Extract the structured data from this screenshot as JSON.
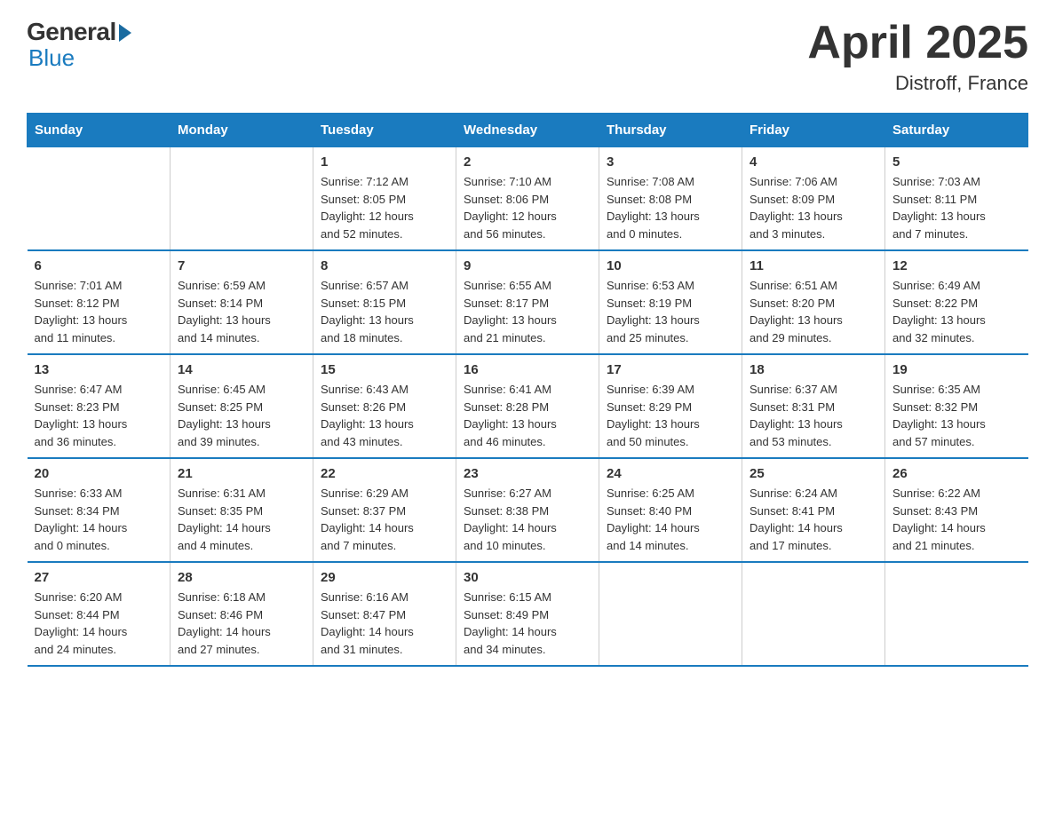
{
  "logo": {
    "general": "General",
    "blue": "Blue",
    "subtitle": "Blue"
  },
  "title": "April 2025",
  "location": "Distroff, France",
  "headers": [
    "Sunday",
    "Monday",
    "Tuesday",
    "Wednesday",
    "Thursday",
    "Friday",
    "Saturday"
  ],
  "weeks": [
    [
      {
        "day": "",
        "info": ""
      },
      {
        "day": "",
        "info": ""
      },
      {
        "day": "1",
        "info": "Sunrise: 7:12 AM\nSunset: 8:05 PM\nDaylight: 12 hours\nand 52 minutes."
      },
      {
        "day": "2",
        "info": "Sunrise: 7:10 AM\nSunset: 8:06 PM\nDaylight: 12 hours\nand 56 minutes."
      },
      {
        "day": "3",
        "info": "Sunrise: 7:08 AM\nSunset: 8:08 PM\nDaylight: 13 hours\nand 0 minutes."
      },
      {
        "day": "4",
        "info": "Sunrise: 7:06 AM\nSunset: 8:09 PM\nDaylight: 13 hours\nand 3 minutes."
      },
      {
        "day": "5",
        "info": "Sunrise: 7:03 AM\nSunset: 8:11 PM\nDaylight: 13 hours\nand 7 minutes."
      }
    ],
    [
      {
        "day": "6",
        "info": "Sunrise: 7:01 AM\nSunset: 8:12 PM\nDaylight: 13 hours\nand 11 minutes."
      },
      {
        "day": "7",
        "info": "Sunrise: 6:59 AM\nSunset: 8:14 PM\nDaylight: 13 hours\nand 14 minutes."
      },
      {
        "day": "8",
        "info": "Sunrise: 6:57 AM\nSunset: 8:15 PM\nDaylight: 13 hours\nand 18 minutes."
      },
      {
        "day": "9",
        "info": "Sunrise: 6:55 AM\nSunset: 8:17 PM\nDaylight: 13 hours\nand 21 minutes."
      },
      {
        "day": "10",
        "info": "Sunrise: 6:53 AM\nSunset: 8:19 PM\nDaylight: 13 hours\nand 25 minutes."
      },
      {
        "day": "11",
        "info": "Sunrise: 6:51 AM\nSunset: 8:20 PM\nDaylight: 13 hours\nand 29 minutes."
      },
      {
        "day": "12",
        "info": "Sunrise: 6:49 AM\nSunset: 8:22 PM\nDaylight: 13 hours\nand 32 minutes."
      }
    ],
    [
      {
        "day": "13",
        "info": "Sunrise: 6:47 AM\nSunset: 8:23 PM\nDaylight: 13 hours\nand 36 minutes."
      },
      {
        "day": "14",
        "info": "Sunrise: 6:45 AM\nSunset: 8:25 PM\nDaylight: 13 hours\nand 39 minutes."
      },
      {
        "day": "15",
        "info": "Sunrise: 6:43 AM\nSunset: 8:26 PM\nDaylight: 13 hours\nand 43 minutes."
      },
      {
        "day": "16",
        "info": "Sunrise: 6:41 AM\nSunset: 8:28 PM\nDaylight: 13 hours\nand 46 minutes."
      },
      {
        "day": "17",
        "info": "Sunrise: 6:39 AM\nSunset: 8:29 PM\nDaylight: 13 hours\nand 50 minutes."
      },
      {
        "day": "18",
        "info": "Sunrise: 6:37 AM\nSunset: 8:31 PM\nDaylight: 13 hours\nand 53 minutes."
      },
      {
        "day": "19",
        "info": "Sunrise: 6:35 AM\nSunset: 8:32 PM\nDaylight: 13 hours\nand 57 minutes."
      }
    ],
    [
      {
        "day": "20",
        "info": "Sunrise: 6:33 AM\nSunset: 8:34 PM\nDaylight: 14 hours\nand 0 minutes."
      },
      {
        "day": "21",
        "info": "Sunrise: 6:31 AM\nSunset: 8:35 PM\nDaylight: 14 hours\nand 4 minutes."
      },
      {
        "day": "22",
        "info": "Sunrise: 6:29 AM\nSunset: 8:37 PM\nDaylight: 14 hours\nand 7 minutes."
      },
      {
        "day": "23",
        "info": "Sunrise: 6:27 AM\nSunset: 8:38 PM\nDaylight: 14 hours\nand 10 minutes."
      },
      {
        "day": "24",
        "info": "Sunrise: 6:25 AM\nSunset: 8:40 PM\nDaylight: 14 hours\nand 14 minutes."
      },
      {
        "day": "25",
        "info": "Sunrise: 6:24 AM\nSunset: 8:41 PM\nDaylight: 14 hours\nand 17 minutes."
      },
      {
        "day": "26",
        "info": "Sunrise: 6:22 AM\nSunset: 8:43 PM\nDaylight: 14 hours\nand 21 minutes."
      }
    ],
    [
      {
        "day": "27",
        "info": "Sunrise: 6:20 AM\nSunset: 8:44 PM\nDaylight: 14 hours\nand 24 minutes."
      },
      {
        "day": "28",
        "info": "Sunrise: 6:18 AM\nSunset: 8:46 PM\nDaylight: 14 hours\nand 27 minutes."
      },
      {
        "day": "29",
        "info": "Sunrise: 6:16 AM\nSunset: 8:47 PM\nDaylight: 14 hours\nand 31 minutes."
      },
      {
        "day": "30",
        "info": "Sunrise: 6:15 AM\nSunset: 8:49 PM\nDaylight: 14 hours\nand 34 minutes."
      },
      {
        "day": "",
        "info": ""
      },
      {
        "day": "",
        "info": ""
      },
      {
        "day": "",
        "info": ""
      }
    ]
  ]
}
